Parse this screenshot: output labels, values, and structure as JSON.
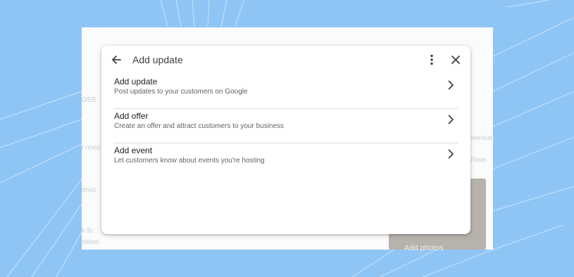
{
  "dialog": {
    "title": "Add update",
    "icons": {
      "back": "arrow-back-icon",
      "more": "more-vert-icon",
      "close": "close-icon"
    },
    "options": [
      {
        "title": "Add update",
        "subtitle": "Post updates to your customers on Google",
        "icon": "chevron-right-icon"
      },
      {
        "title": "Add offer",
        "subtitle": "Create an offer and attract customers to your business",
        "icon": "chevron-right-icon"
      },
      {
        "title": "Add event",
        "subtitle": "Let customers know about events you're hosting",
        "icon": "chevron-right-icon"
      }
    ]
  },
  "background": {
    "fragments": [
      "oss",
      "l revie",
      "ervic",
      "k fo",
      "views",
      "ownload",
      "Rleas"
    ],
    "photo_label": "Add photos"
  },
  "colors": {
    "background": "#8fc5f5",
    "dialog": "#ffffff",
    "divider": "#dadce0",
    "title_text": "#3c4043",
    "subtitle_text": "#5f6368"
  }
}
